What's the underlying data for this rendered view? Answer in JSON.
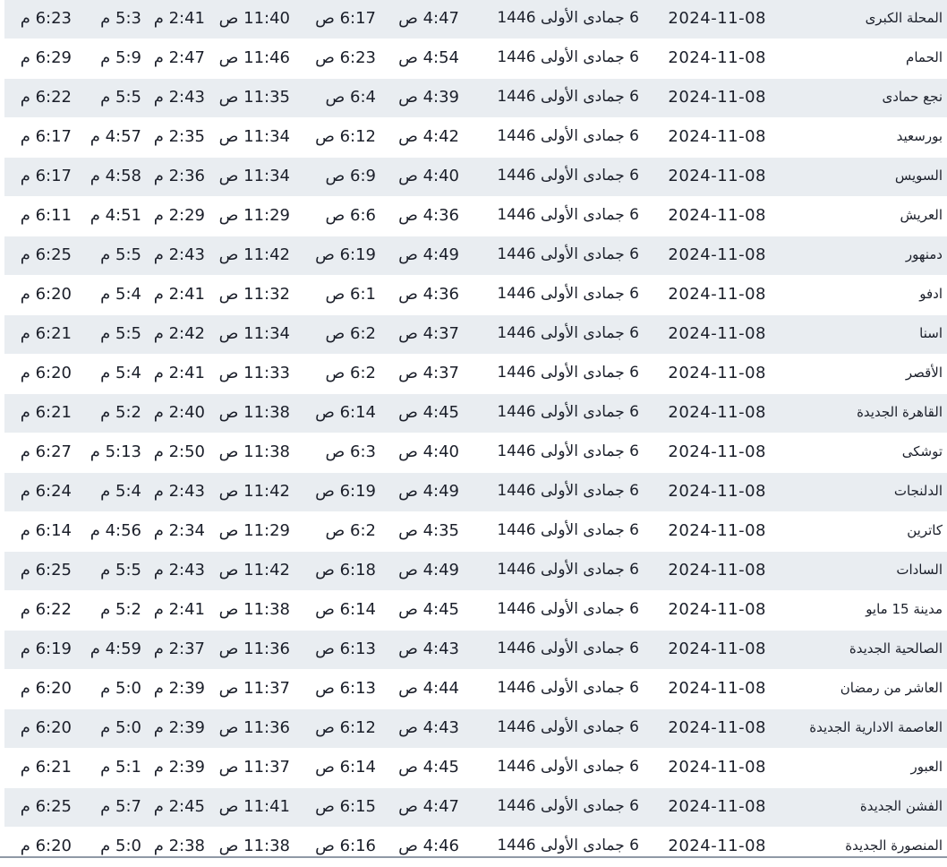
{
  "table": {
    "rows": [
      {
        "city": "المحلة الكبرى",
        "gregorian": "2024-11-08",
        "hijri": "6 جمادى الأولى 1446",
        "fajr": "4:47 ص",
        "sunrise": "6:17 ص",
        "dhuhr": "11:40 ص",
        "asr": "2:41 م",
        "maghrib": "5:3 م",
        "isha": "6:23 م"
      },
      {
        "city": "الحمام",
        "gregorian": "2024-11-08",
        "hijri": "6 جمادى الأولى 1446",
        "fajr": "4:54 ص",
        "sunrise": "6:23 ص",
        "dhuhr": "11:46 ص",
        "asr": "2:47 م",
        "maghrib": "5:9 م",
        "isha": "6:29 م"
      },
      {
        "city": "نجع حمادى",
        "gregorian": "2024-11-08",
        "hijri": "6 جمادى الأولى 1446",
        "fajr": "4:39 ص",
        "sunrise": "6:4 ص",
        "dhuhr": "11:35 ص",
        "asr": "2:43 م",
        "maghrib": "5:5 م",
        "isha": "6:22 م"
      },
      {
        "city": "بورسعيد",
        "gregorian": "2024-11-08",
        "hijri": "6 جمادى الأولى 1446",
        "fajr": "4:42 ص",
        "sunrise": "6:12 ص",
        "dhuhr": "11:34 ص",
        "asr": "2:35 م",
        "maghrib": "4:57 م",
        "isha": "6:17 م"
      },
      {
        "city": "السويس",
        "gregorian": "2024-11-08",
        "hijri": "6 جمادى الأولى 1446",
        "fajr": "4:40 ص",
        "sunrise": "6:9 ص",
        "dhuhr": "11:34 ص",
        "asr": "2:36 م",
        "maghrib": "4:58 م",
        "isha": "6:17 م"
      },
      {
        "city": "العريش",
        "gregorian": "2024-11-08",
        "hijri": "6 جمادى الأولى 1446",
        "fajr": "4:36 ص",
        "sunrise": "6:6 ص",
        "dhuhr": "11:29 ص",
        "asr": "2:29 م",
        "maghrib": "4:51 م",
        "isha": "6:11 م"
      },
      {
        "city": "دمنهور",
        "gregorian": "2024-11-08",
        "hijri": "6 جمادى الأولى 1446",
        "fajr": "4:49 ص",
        "sunrise": "6:19 ص",
        "dhuhr": "11:42 ص",
        "asr": "2:43 م",
        "maghrib": "5:5 م",
        "isha": "6:25 م"
      },
      {
        "city": "ادفو",
        "gregorian": "2024-11-08",
        "hijri": "6 جمادى الأولى 1446",
        "fajr": "4:36 ص",
        "sunrise": "6:1 ص",
        "dhuhr": "11:32 ص",
        "asr": "2:41 م",
        "maghrib": "5:4 م",
        "isha": "6:20 م"
      },
      {
        "city": "اسنا",
        "gregorian": "2024-11-08",
        "hijri": "6 جمادى الأولى 1446",
        "fajr": "4:37 ص",
        "sunrise": "6:2 ص",
        "dhuhr": "11:34 ص",
        "asr": "2:42 م",
        "maghrib": "5:5 م",
        "isha": "6:21 م"
      },
      {
        "city": "الأقصر",
        "gregorian": "2024-11-08",
        "hijri": "6 جمادى الأولى 1446",
        "fajr": "4:37 ص",
        "sunrise": "6:2 ص",
        "dhuhr": "11:33 ص",
        "asr": "2:41 م",
        "maghrib": "5:4 م",
        "isha": "6:20 م"
      },
      {
        "city": "القاهرة الجديدة",
        "gregorian": "2024-11-08",
        "hijri": "6 جمادى الأولى 1446",
        "fajr": "4:45 ص",
        "sunrise": "6:14 ص",
        "dhuhr": "11:38 ص",
        "asr": "2:40 م",
        "maghrib": "5:2 م",
        "isha": "6:21 م"
      },
      {
        "city": "توشكى",
        "gregorian": "2024-11-08",
        "hijri": "6 جمادى الأولى 1446",
        "fajr": "4:40 ص",
        "sunrise": "6:3 ص",
        "dhuhr": "11:38 ص",
        "asr": "2:50 م",
        "maghrib": "5:13 م",
        "isha": "6:27 م"
      },
      {
        "city": "الدلنجات",
        "gregorian": "2024-11-08",
        "hijri": "6 جمادى الأولى 1446",
        "fajr": "4:49 ص",
        "sunrise": "6:19 ص",
        "dhuhr": "11:42 ص",
        "asr": "2:43 م",
        "maghrib": "5:4 م",
        "isha": "6:24 م"
      },
      {
        "city": "كاترين",
        "gregorian": "2024-11-08",
        "hijri": "6 جمادى الأولى 1446",
        "fajr": "4:35 ص",
        "sunrise": "6:2 ص",
        "dhuhr": "11:29 ص",
        "asr": "2:34 م",
        "maghrib": "4:56 م",
        "isha": "6:14 م"
      },
      {
        "city": "السادات",
        "gregorian": "2024-11-08",
        "hijri": "6 جمادى الأولى 1446",
        "fajr": "4:49 ص",
        "sunrise": "6:18 ص",
        "dhuhr": "11:42 ص",
        "asr": "2:43 م",
        "maghrib": "5:5 م",
        "isha": "6:25 م"
      },
      {
        "city": "مدينة 15 مايو",
        "gregorian": "2024-11-08",
        "hijri": "6 جمادى الأولى 1446",
        "fajr": "4:45 ص",
        "sunrise": "6:14 ص",
        "dhuhr": "11:38 ص",
        "asr": "2:41 م",
        "maghrib": "5:2 م",
        "isha": "6:22 م"
      },
      {
        "city": "الصالحية الجديدة",
        "gregorian": "2024-11-08",
        "hijri": "6 جمادى الأولى 1446",
        "fajr": "4:43 ص",
        "sunrise": "6:13 ص",
        "dhuhr": "11:36 ص",
        "asr": "2:37 م",
        "maghrib": "4:59 م",
        "isha": "6:19 م"
      },
      {
        "city": "العاشر من رمضان",
        "gregorian": "2024-11-08",
        "hijri": "6 جمادى الأولى 1446",
        "fajr": "4:44 ص",
        "sunrise": "6:13 ص",
        "dhuhr": "11:37 ص",
        "asr": "2:39 م",
        "maghrib": "5:0 م",
        "isha": "6:20 م"
      },
      {
        "city": "العاصمة الادارية الجديدة",
        "gregorian": "2024-11-08",
        "hijri": "6 جمادى الأولى 1446",
        "fajr": "4:43 ص",
        "sunrise": "6:12 ص",
        "dhuhr": "11:36 ص",
        "asr": "2:39 م",
        "maghrib": "5:0 م",
        "isha": "6:20 م"
      },
      {
        "city": "العبور",
        "gregorian": "2024-11-08",
        "hijri": "6 جمادى الأولى 1446",
        "fajr": "4:45 ص",
        "sunrise": "6:14 ص",
        "dhuhr": "11:37 ص",
        "asr": "2:39 م",
        "maghrib": "5:1 م",
        "isha": "6:21 م"
      },
      {
        "city": "الفشن الجديدة",
        "gregorian": "2024-11-08",
        "hijri": "6 جمادى الأولى 1446",
        "fajr": "4:47 ص",
        "sunrise": "6:15 ص",
        "dhuhr": "11:41 ص",
        "asr": "2:45 م",
        "maghrib": "5:7 م",
        "isha": "6:25 م"
      },
      {
        "city": "المنصورة الجديدة",
        "gregorian": "2024-11-08",
        "hijri": "6 جمادى الأولى 1446",
        "fajr": "4:46 ص",
        "sunrise": "6:16 ص",
        "dhuhr": "11:38 ص",
        "asr": "2:38 م",
        "maghrib": "5:0 م",
        "isha": "6:20 م"
      }
    ]
  }
}
